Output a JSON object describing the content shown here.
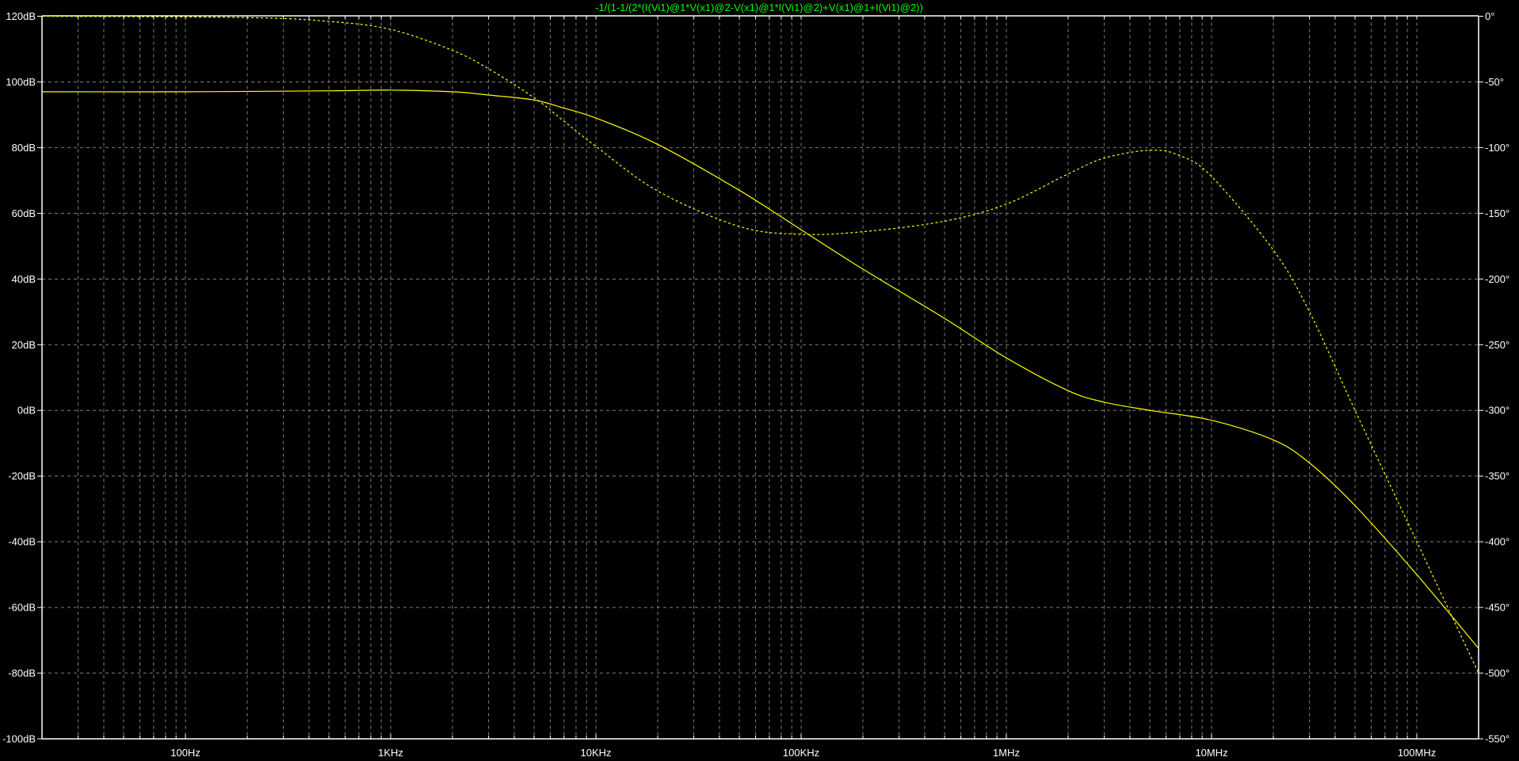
{
  "chart_data": {
    "type": "line",
    "title": "-1/(1-1/(2*(I(Vi1)@1*V(x1)@2-V(x1)@1*I(Vi1)@2)+V(x1)@1+I(Vi1)@2))",
    "x_scale": "log",
    "xlim": [
      20,
      200000000
    ],
    "x_tick_labels": [
      {
        "value": 100,
        "label": "100Hz"
      },
      {
        "value": 1000,
        "label": "1KHz"
      },
      {
        "value": 10000,
        "label": "10KHz"
      },
      {
        "value": 100000,
        "label": "100KHz"
      },
      {
        "value": 1000000,
        "label": "1MHz"
      },
      {
        "value": 10000000,
        "label": "10MHz"
      },
      {
        "value": 100000000,
        "label": "100MHz"
      }
    ],
    "y_left": {
      "ylim": [
        -100,
        120
      ],
      "ticks": [
        120,
        100,
        80,
        60,
        40,
        20,
        0,
        -20,
        -40,
        -60,
        -80,
        -100
      ],
      "tick_labels": [
        "120dB",
        "100dB",
        "80dB",
        "60dB",
        "40dB",
        "20dB",
        "0dB",
        "-20dB",
        "-40dB",
        "-60dB",
        "-80dB",
        "-100dB"
      ]
    },
    "y_right": {
      "ylim": [
        -550,
        0
      ],
      "ticks": [
        0,
        -50,
        -100,
        -150,
        -200,
        -250,
        -300,
        -350,
        -400,
        -450,
        -500,
        -550
      ],
      "tick_labels": [
        "0°",
        "-50°",
        "-100°",
        "-150°",
        "-200°",
        "-250°",
        "-300°",
        "-350°",
        "-400°",
        "-450°",
        "-500°",
        "-550°"
      ]
    },
    "grid": true,
    "series": [
      {
        "kind": "magnitude",
        "axis": "left",
        "style": "solid",
        "color": "#ffff00",
        "x": [
          20,
          100,
          500,
          1000,
          2000,
          3000,
          5000,
          7000,
          10000,
          20000,
          50000,
          100000,
          200000,
          500000,
          1000000,
          2000000,
          3000000,
          5000000,
          10000000,
          20000000,
          30000000,
          50000000,
          100000000,
          200000000
        ],
        "y": [
          97,
          97,
          97.3,
          97.5,
          97,
          96,
          94.5,
          92,
          89,
          81,
          67,
          55,
          43,
          28,
          16,
          6,
          2.5,
          0,
          -3,
          -9,
          -16,
          -29,
          -50,
          -72.5
        ]
      },
      {
        "kind": "phase",
        "axis": "right",
        "style": "dashed",
        "color": "#ffff00",
        "x": [
          20,
          200,
          500,
          1000,
          2000,
          3000,
          5000,
          7000,
          10000,
          20000,
          50000,
          100000,
          200000,
          500000,
          1000000,
          2000000,
          3000000,
          5000000,
          7000000,
          10000000,
          20000000,
          30000000,
          50000000,
          100000000,
          200000000
        ],
        "y": [
          0,
          -1,
          -4,
          -10,
          -26,
          -40,
          -62,
          -80,
          -99,
          -133,
          -160,
          -166,
          -164,
          -156,
          -143,
          -120,
          -108,
          -102,
          -106,
          -122,
          -178,
          -225,
          -300,
          -400,
          -500
        ]
      }
    ],
    "colors": {
      "background": "#000000",
      "title": "#00ff00",
      "axes": "#ffffff",
      "grid": "#808080"
    }
  }
}
